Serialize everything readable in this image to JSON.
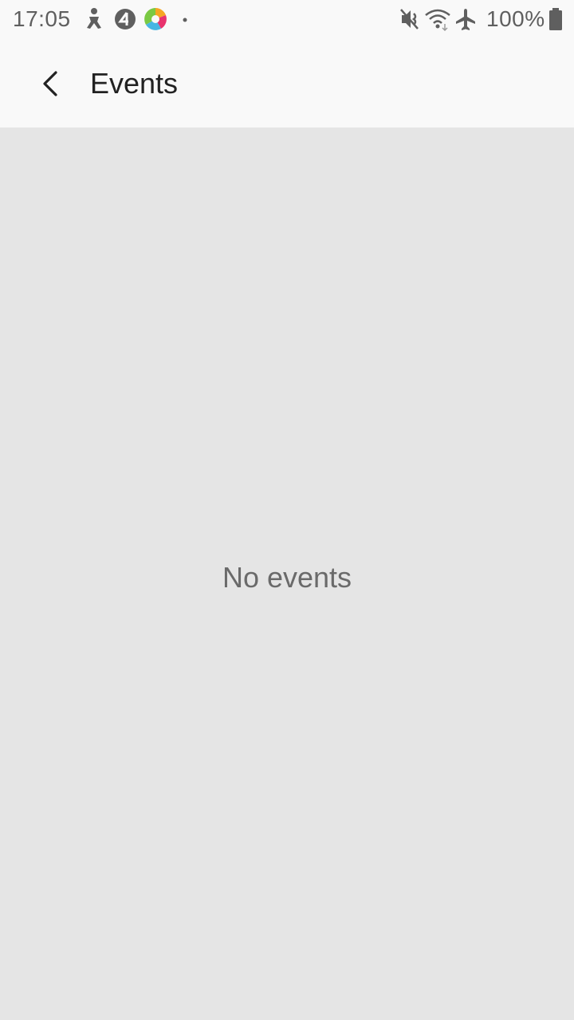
{
  "status_bar": {
    "time": "17:05",
    "left_icons": [
      "accessibility-icon",
      "channel4-icon",
      "camera-app-icon",
      "more-notifications-dot-icon"
    ],
    "right_icons": [
      "vibrate-mute-icon",
      "wifi-icon",
      "airplane-mode-icon",
      "battery-icon"
    ],
    "battery": "100%"
  },
  "app_bar": {
    "title": "Events",
    "back_icon": "chevron-left-icon"
  },
  "content": {
    "empty_message": "No events"
  },
  "colors": {
    "bar_background": "#f9f9f9",
    "content_background": "#e5e5e5",
    "title_text": "#222222",
    "empty_text": "#6a6a6a",
    "status_text": "#5f5f5f"
  }
}
